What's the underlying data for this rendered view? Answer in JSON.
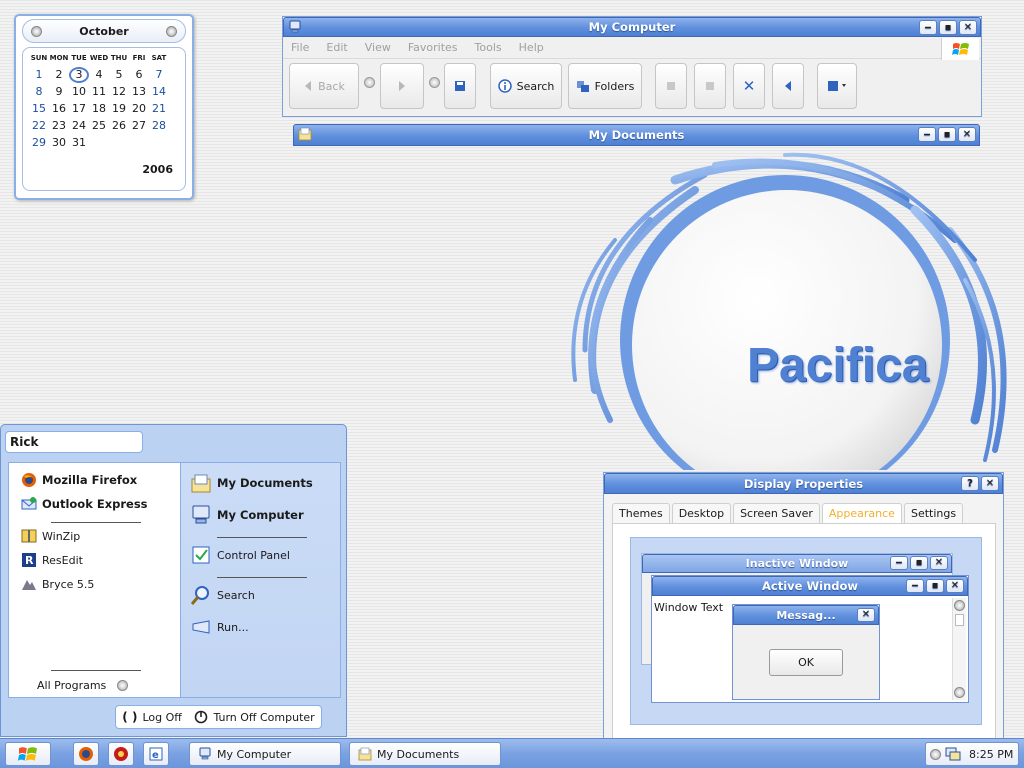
{
  "calendar": {
    "month": "October",
    "year": "2006",
    "day_names": [
      "SUN",
      "MON",
      "TUE",
      "WED",
      "THU",
      "FRI",
      "SAT"
    ],
    "weeks": [
      [
        "1",
        "2",
        "3",
        "4",
        "5",
        "6",
        "7"
      ],
      [
        "8",
        "9",
        "10",
        "11",
        "12",
        "13",
        "14"
      ],
      [
        "15",
        "16",
        "17",
        "18",
        "19",
        "20",
        "21"
      ],
      [
        "22",
        "23",
        "24",
        "25",
        "26",
        "27",
        "28"
      ],
      [
        "29",
        "30",
        "31",
        "",
        "",
        "",
        ""
      ]
    ],
    "today": "3"
  },
  "mycomputer": {
    "title": "My Computer",
    "menu": [
      "File",
      "Edit",
      "View",
      "Favorites",
      "Tools",
      "Help"
    ],
    "toolbar": {
      "back": "Back",
      "search": "Search",
      "folders": "Folders"
    }
  },
  "mydocs": {
    "title": "My Documents"
  },
  "logo": {
    "text": "Pacifica"
  },
  "startmenu": {
    "user": "Rick",
    "pinned": [
      "Mozilla Firefox",
      "Outlook Express"
    ],
    "recent": [
      "WinZip",
      "ResEdit",
      "Bryce 5.5"
    ],
    "all_programs": "All Programs",
    "right": {
      "my_documents": "My Documents",
      "my_computer": "My Computer",
      "control_panel": "Control Panel",
      "search": "Search",
      "run": "Run..."
    },
    "log_off": "Log Off",
    "turn_off": "Turn Off Computer"
  },
  "display_properties": {
    "title": "Display Properties",
    "tabs": [
      "Themes",
      "Desktop",
      "Screen Saver",
      "Appearance",
      "Settings"
    ],
    "active_tab": "Appearance",
    "preview": {
      "inactive_title": "Inactive Window",
      "active_title": "Active Window",
      "window_text": "Window Text",
      "message_title": "Messag...",
      "ok": "OK"
    }
  },
  "taskbar": {
    "tasks": [
      "My Computer",
      "My Documents"
    ],
    "clock": "8:25 PM"
  },
  "colors": {
    "title_blue": "#5f8fdd",
    "accent_blue": "#4f80d2",
    "active_tab": "#f0b030",
    "logo_text": "#4f80d2"
  }
}
